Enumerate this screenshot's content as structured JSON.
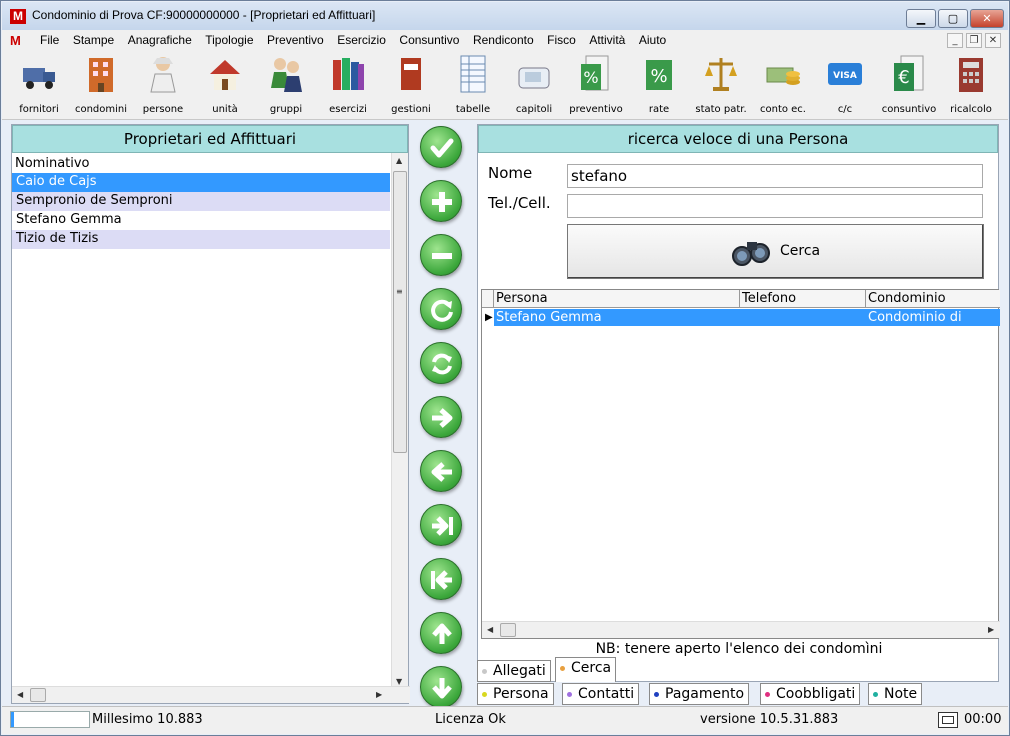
{
  "window": {
    "title": "Condominio di Prova CF:90000000000 - [Proprietari ed Affittuari]",
    "logo": "M",
    "controls": {
      "minimize": "▁",
      "maximize": "▢",
      "close": "✕"
    },
    "mdi_controls": {
      "minimize": "_",
      "restore": "❐",
      "close": "✕"
    }
  },
  "menu": {
    "logo": "M",
    "items": [
      "File",
      "Stampe",
      "Anagrafiche",
      "Tipologie",
      "Preventivo",
      "Esercizio",
      "Consuntivo",
      "Rendiconto",
      "Fisco",
      "Attività",
      "Aiuto"
    ]
  },
  "toolbar": {
    "items": [
      {
        "label": "fornitori",
        "icon": "truck-icon"
      },
      {
        "label": "condomini",
        "icon": "building-icon"
      },
      {
        "label": "persone",
        "icon": "person-icon"
      },
      {
        "label": "unità",
        "icon": "house-icon"
      },
      {
        "label": "gruppi",
        "icon": "group-icon"
      },
      {
        "label": "esercizi",
        "icon": "books-icon"
      },
      {
        "label": "gestioni",
        "icon": "binder-icon"
      },
      {
        "label": "tabelle",
        "icon": "table-icon"
      },
      {
        "label": "capitoli",
        "icon": "phone-icon"
      },
      {
        "label": "preventivo",
        "icon": "percent-doc-icon"
      },
      {
        "label": "rate",
        "icon": "percent-icon"
      },
      {
        "label": "stato patr.",
        "icon": "scales-icon"
      },
      {
        "label": "conto ec.",
        "icon": "coins-icon"
      },
      {
        "label": "c/c",
        "icon": "card-icon"
      },
      {
        "label": "consuntivo",
        "icon": "euro-doc-icon"
      },
      {
        "label": "ricalcolo",
        "icon": "calculator-icon"
      }
    ]
  },
  "left_panel": {
    "header": "Proprietari ed Affittuari",
    "column": "Nominativo",
    "rows": [
      "Caio de Cajs",
      "Sempronio de Semproni",
      "Stefano Gemma",
      "Tizio de Tizis"
    ],
    "selected_row": 0
  },
  "nav_buttons": [
    "confirm",
    "add",
    "remove",
    "refresh",
    "reload",
    "next",
    "previous",
    "last",
    "first",
    "up",
    "down"
  ],
  "search_panel": {
    "header": "ricerca veloce di una Persona",
    "name_label": "Nome",
    "name_value": "stefano",
    "phone_label": "Tel./Cell.",
    "phone_value": "",
    "search_button": "Cerca",
    "columns": [
      "Persona",
      "Telefono",
      "Condominio"
    ],
    "results": [
      {
        "persona": "Stefano Gemma",
        "telefono": "",
        "condominio": "Condominio di Prova"
      }
    ],
    "note": "NB: tenere aperto l'elenco dei condomìni"
  },
  "tabs_top": [
    {
      "label": "Allegati",
      "dot": "#c8c8c8"
    },
    {
      "label": "Cerca",
      "dot": "#e8a040"
    }
  ],
  "tabs_bottom": [
    {
      "label": "Persona",
      "dot": "#d8d820"
    },
    {
      "label": "Contatti",
      "dot": "#a070e0"
    },
    {
      "label": "Pagamento",
      "dot": "#2040c0"
    },
    {
      "label": "Coobbligati",
      "dot": "#e03080"
    },
    {
      "label": "Note",
      "dot": "#20b0a0"
    }
  ],
  "status": {
    "millesimo": "Millesimo 10.883",
    "licenza": "Licenza Ok",
    "versione": "versione 10.5.31.883",
    "time": "00:00"
  }
}
